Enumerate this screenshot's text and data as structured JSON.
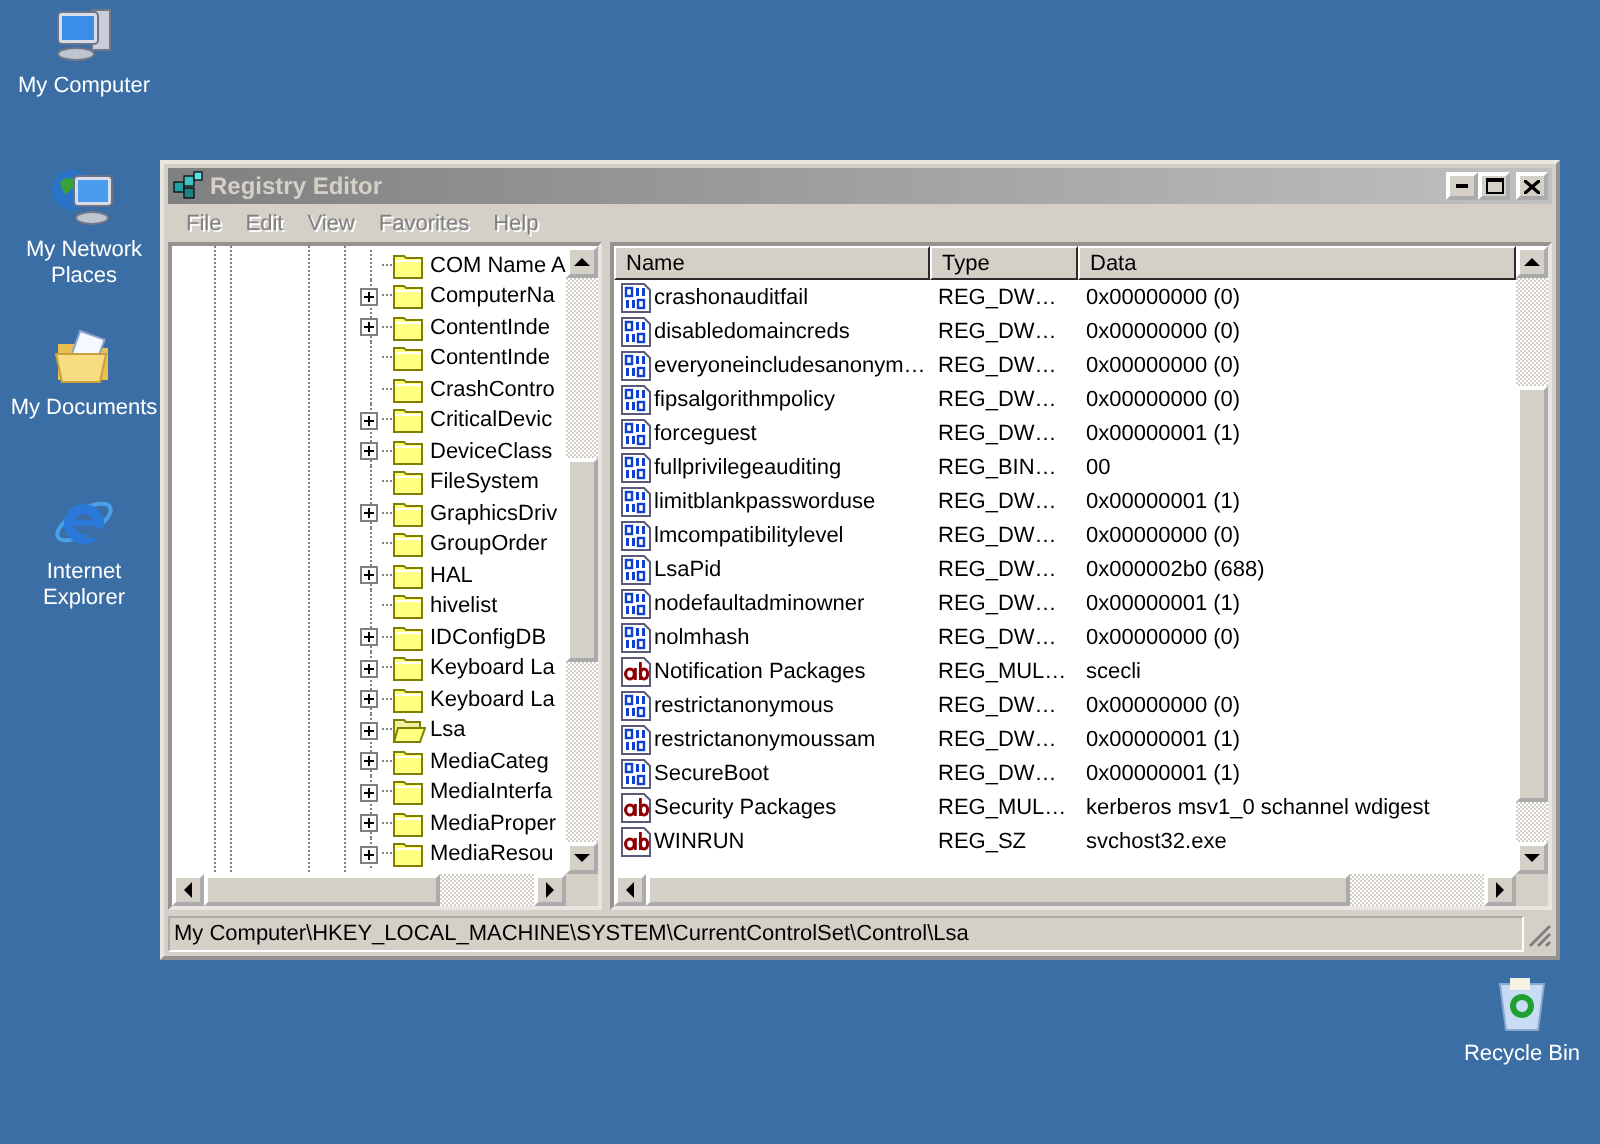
{
  "desktop_icons": [
    {
      "label": "My Computer",
      "kind": "computer"
    },
    {
      "label": "My Network Places",
      "kind": "network"
    },
    {
      "label": "My Documents",
      "kind": "documents"
    },
    {
      "label": "Internet Explorer",
      "kind": "browser"
    },
    {
      "label": "Recycle Bin",
      "kind": "recycle"
    }
  ],
  "window": {
    "title": "Registry Editor"
  },
  "menu": [
    "File",
    "Edit",
    "View",
    "Favorites",
    "Help"
  ],
  "tree": {
    "items": [
      {
        "label": "COM Name A",
        "expandable": false,
        "selected": false
      },
      {
        "label": "ComputerNa",
        "expandable": true,
        "selected": false
      },
      {
        "label": "ContentInde",
        "expandable": true,
        "selected": false
      },
      {
        "label": "ContentInde",
        "expandable": false,
        "selected": false
      },
      {
        "label": "CrashContro",
        "expandable": false,
        "selected": false
      },
      {
        "label": "CriticalDevic",
        "expandable": true,
        "selected": false
      },
      {
        "label": "DeviceClass",
        "expandable": true,
        "selected": false
      },
      {
        "label": "FileSystem",
        "expandable": false,
        "selected": false
      },
      {
        "label": "GraphicsDriv",
        "expandable": true,
        "selected": false
      },
      {
        "label": "GroupOrder",
        "expandable": false,
        "selected": false
      },
      {
        "label": "HAL",
        "expandable": true,
        "selected": false
      },
      {
        "label": "hivelist",
        "expandable": false,
        "selected": false
      },
      {
        "label": "IDConfigDB",
        "expandable": true,
        "selected": false
      },
      {
        "label": "Keyboard La",
        "expandable": true,
        "selected": false
      },
      {
        "label": "Keyboard La",
        "expandable": true,
        "selected": false
      },
      {
        "label": "Lsa",
        "expandable": true,
        "selected": true
      },
      {
        "label": "MediaCateg",
        "expandable": true,
        "selected": false
      },
      {
        "label": "MediaInterfa",
        "expandable": true,
        "selected": false
      },
      {
        "label": "MediaProper",
        "expandable": true,
        "selected": false
      },
      {
        "label": "MediaResou",
        "expandable": true,
        "selected": false
      }
    ]
  },
  "values": {
    "columns": [
      "Name",
      "Type",
      "Data"
    ],
    "rows": [
      {
        "kind": "binary",
        "name": "crashonauditfail",
        "type": "REG_DW…",
        "data": "0x00000000 (0)"
      },
      {
        "kind": "binary",
        "name": "disabledomaincreds",
        "type": "REG_DW…",
        "data": "0x00000000 (0)"
      },
      {
        "kind": "binary",
        "name": "everyoneincludesanonym…",
        "type": "REG_DW…",
        "data": "0x00000000 (0)"
      },
      {
        "kind": "binary",
        "name": "fipsalgorithmpolicy",
        "type": "REG_DW…",
        "data": "0x00000000 (0)"
      },
      {
        "kind": "binary",
        "name": "forceguest",
        "type": "REG_DW…",
        "data": "0x00000001 (1)"
      },
      {
        "kind": "binary",
        "name": "fullprivilegeauditing",
        "type": "REG_BIN…",
        "data": "00"
      },
      {
        "kind": "binary",
        "name": "limitblankpassworduse",
        "type": "REG_DW…",
        "data": "0x00000001 (1)"
      },
      {
        "kind": "binary",
        "name": "lmcompatibilitylevel",
        "type": "REG_DW…",
        "data": "0x00000000 (0)"
      },
      {
        "kind": "binary",
        "name": "LsaPid",
        "type": "REG_DW…",
        "data": "0x000002b0 (688)"
      },
      {
        "kind": "binary",
        "name": "nodefaultadminowner",
        "type": "REG_DW…",
        "data": "0x00000001 (1)"
      },
      {
        "kind": "binary",
        "name": "nolmhash",
        "type": "REG_DW…",
        "data": "0x00000000 (0)"
      },
      {
        "kind": "string",
        "name": "Notification Packages",
        "type": "REG_MUL…",
        "data": "scecli"
      },
      {
        "kind": "binary",
        "name": "restrictanonymous",
        "type": "REG_DW…",
        "data": "0x00000000 (0)"
      },
      {
        "kind": "binary",
        "name": "restrictanonymoussam",
        "type": "REG_DW…",
        "data": "0x00000001 (1)"
      },
      {
        "kind": "binary",
        "name": "SecureBoot",
        "type": "REG_DW…",
        "data": "0x00000001 (1)"
      },
      {
        "kind": "string",
        "name": "Security Packages",
        "type": "REG_MUL…",
        "data": "kerberos msv1_0 schannel wdigest"
      },
      {
        "kind": "string",
        "name": "WINRUN",
        "type": "REG_SZ",
        "data": "svchost32.exe"
      }
    ]
  },
  "status_bar": "My Computer\\HKEY_LOCAL_MACHINE\\SYSTEM\\CurrentControlSet\\Control\\Lsa"
}
